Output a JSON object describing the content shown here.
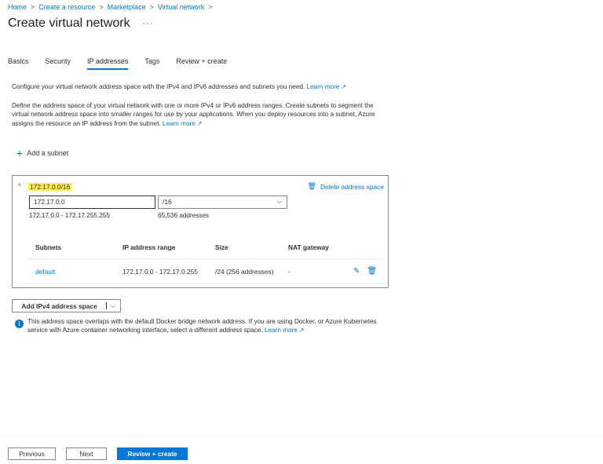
{
  "breadcrumb": {
    "items": [
      "Home",
      "Create a resource",
      "Marketplace",
      "Virtual network"
    ],
    "separator": ">"
  },
  "page": {
    "title": "Create virtual network",
    "more_label": "···"
  },
  "tabs": [
    {
      "label": "Basics"
    },
    {
      "label": "Security"
    },
    {
      "label": "IP addresses",
      "active": true
    },
    {
      "label": "Tags"
    },
    {
      "label": "Review + create"
    }
  ],
  "intro": {
    "p1_text": "Configure your virtual network address space with the IPv4 and IPv6 addresses and subnets you need.",
    "p1_link": "Learn more",
    "p2_text": "Define the address space of your virtual network with one or more IPv4 or IPv6 address ranges. Create subnets to segment the virtual network address space into smaller ranges for use by your applications. When you deploy resources into a subnet, Azure assigns the resource an IP address from the subnet.",
    "p2_link": "Learn more",
    "external_icon": "↗"
  },
  "add_subnet": {
    "icon": "+",
    "label": "Add a subnet"
  },
  "address_space": {
    "collapse_icon": "^",
    "cidr": "172.17.0.0/16",
    "delete_icon": "🗑",
    "delete_label": "Delete address space",
    "address_value": "172.17.0.0",
    "prefix_value": "/16",
    "dropdown_icon": "⌵",
    "range": "172.17.0.0 - 172.17.255.255",
    "count": "65,536 addresses",
    "columns": [
      "Subnets",
      "IP address range",
      "Size",
      "NAT gateway"
    ],
    "subnets": [
      {
        "name": "default",
        "range": "172.17.0.0 - 172.17.0.255",
        "size": "/24 (256 addresses)",
        "nat": "-"
      }
    ],
    "edit_icon": "✎",
    "row_delete_icon": "🗑"
  },
  "add_space_button": {
    "label": "Add IPv4 address space",
    "chevron": "⌵"
  },
  "info": {
    "icon": "i",
    "text": "This address space overlaps with the default Docker bridge network address. If you are using Docker, or Azure Kubernetes service with Azure container networking interface, select a different address space.",
    "link": "Learn more"
  },
  "footer": {
    "previous": "Previous",
    "next": "Next",
    "review": "Review + create"
  },
  "colors": {
    "accent": "#0078d4",
    "highlight": "#fff04b",
    "text": "#323130",
    "border": "#8a8886"
  }
}
